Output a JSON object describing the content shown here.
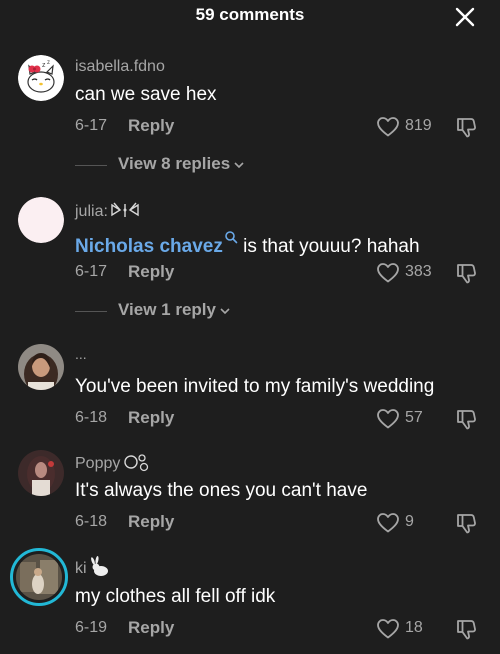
{
  "header": {
    "title": "59 comments"
  },
  "comments": [
    {
      "username": "isabella.fdno",
      "text": "can we save hex",
      "date": "6-17",
      "reply_label": "Reply",
      "likes": "819",
      "view_replies": "View 8 replies"
    },
    {
      "username": "julia:",
      "mention": "Nicholas chavez",
      "text": " is that youuu? hahah",
      "date": "6-17",
      "reply_label": "Reply",
      "likes": "383",
      "view_replies": "View 1 reply"
    },
    {
      "username": "...",
      "text": "You've been invited to my family's wedding",
      "date": "6-18",
      "reply_label": "Reply",
      "likes": "57"
    },
    {
      "username": "Poppy",
      "text": "It's always the ones you can't have",
      "date": "6-18",
      "reply_label": "Reply",
      "likes": "9"
    },
    {
      "username": "ki",
      "text": "my clothes all fell off idk",
      "date": "6-19",
      "reply_label": "Reply",
      "likes": "18"
    }
  ],
  "colors": {
    "background": "#1e1e1e",
    "mention": "#6aa9e8",
    "secondary_text": "#a6a6a6",
    "story_ring": "#22b8d6"
  },
  "icons": [
    "close-icon",
    "heart-icon",
    "dislike-icon",
    "chevron-down-icon",
    "search-icon",
    "rabbit-icon",
    "bow-icon"
  ]
}
